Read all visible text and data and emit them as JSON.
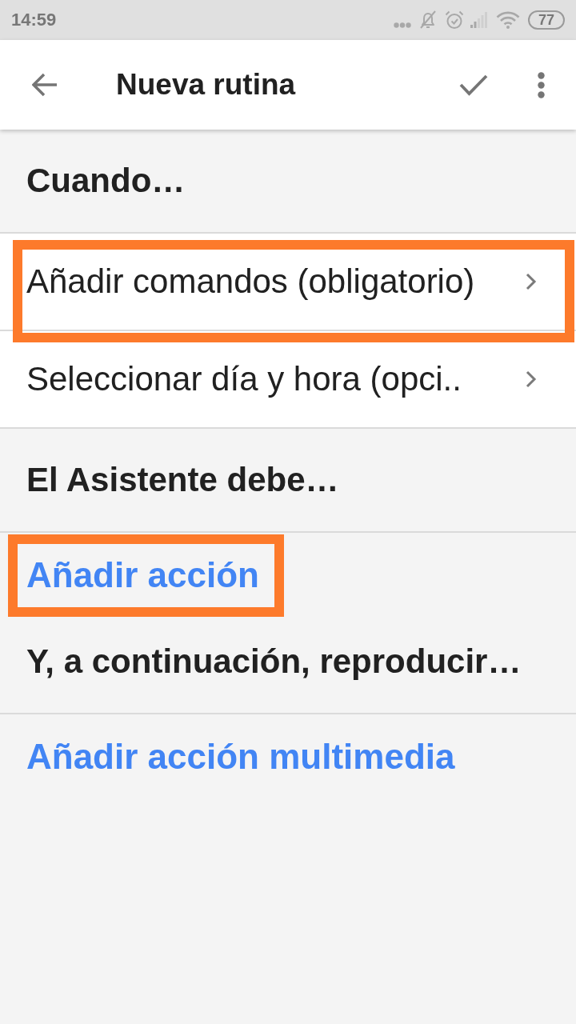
{
  "status_bar": {
    "time": "14:59",
    "battery": "77"
  },
  "app_bar": {
    "title": "Nueva rutina"
  },
  "sections": [
    {
      "heading": "Cuando…",
      "items": [
        {
          "kind": "nav",
          "label": "Añadir comandos (obligatorio)",
          "highlighted": true
        },
        {
          "kind": "nav",
          "label": "Seleccionar día y hora (opci..",
          "highlighted": false
        }
      ]
    },
    {
      "heading": "El Asistente debe…",
      "items": [
        {
          "kind": "link",
          "label": "Añadir acción",
          "highlighted": true
        }
      ]
    },
    {
      "heading": "Y, a continuación, reproducir…",
      "items": [
        {
          "kind": "link",
          "label": "Añadir acción multimedia",
          "highlighted": false
        }
      ]
    }
  ]
}
